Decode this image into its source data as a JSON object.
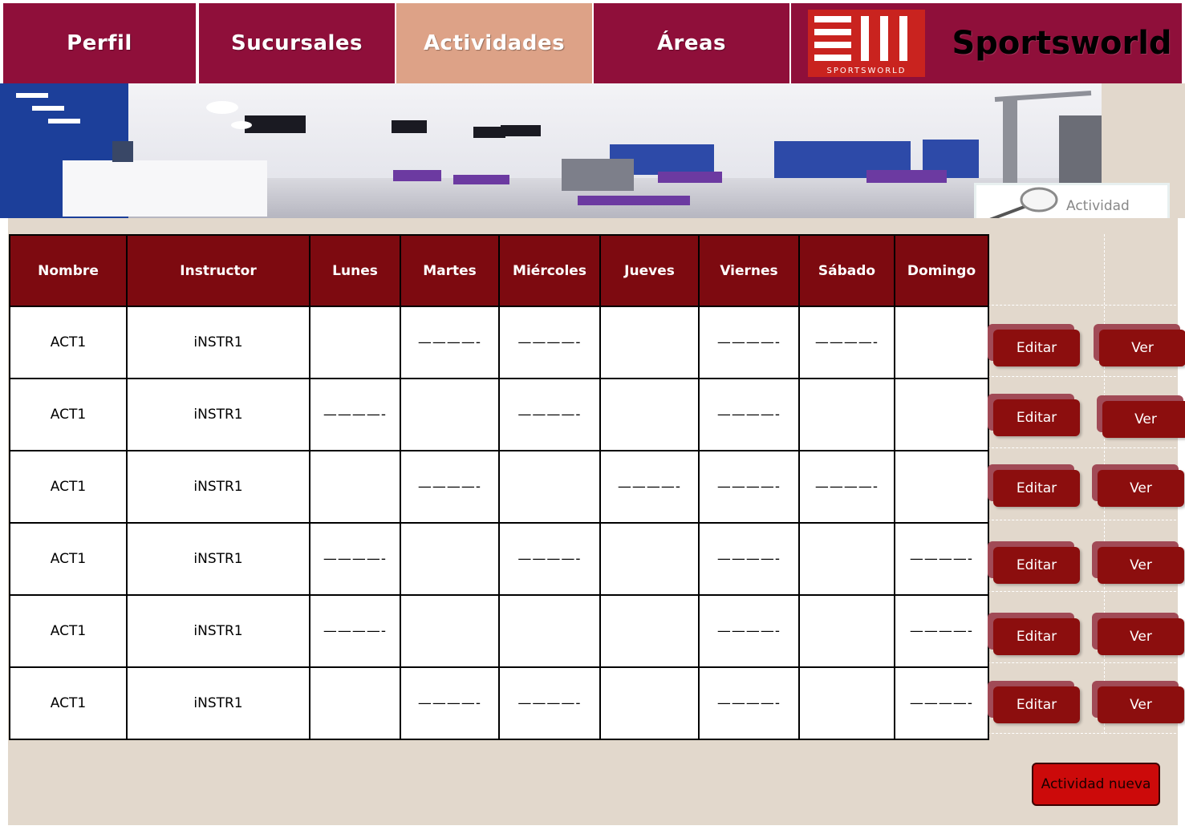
{
  "nav": {
    "tabs": [
      {
        "label": "Perfil",
        "active": false
      },
      {
        "label": "Sucursales",
        "active": false
      },
      {
        "label": "Actividades",
        "active": true
      },
      {
        "label": "Áreas",
        "active": false
      }
    ],
    "logo_caption": "SPORTSWORLD",
    "brand": "Sportsworld"
  },
  "search": {
    "placeholder": "Actividad"
  },
  "table": {
    "headers": [
      "Nombre",
      "Instructor",
      "Lunes",
      "Martes",
      "Miércoles",
      "Jueves",
      "Viernes",
      "Sábado",
      "Domingo"
    ],
    "rows": [
      [
        "ACT1",
        "iNSTR1",
        "",
        "————-",
        "————-",
        "",
        "————-",
        "————-",
        ""
      ],
      [
        "ACT1",
        "iNSTR1",
        "————-",
        "",
        "————-",
        "",
        "————-",
        "",
        ""
      ],
      [
        "ACT1",
        "iNSTR1",
        "",
        "————-",
        "",
        "————-",
        "————-",
        "————-",
        ""
      ],
      [
        "ACT1",
        "iNSTR1",
        "————-",
        "",
        "————-",
        "",
        "————-",
        "",
        "————-"
      ],
      [
        "ACT1",
        "iNSTR1",
        "————-",
        "",
        "",
        "",
        "————-",
        "",
        "————-"
      ],
      [
        "ACT1",
        "iNSTR1",
        "",
        "————-",
        "————-",
        "",
        "————-",
        "",
        "————-"
      ]
    ]
  },
  "row_actions": {
    "edit_label": "Editar",
    "view_label": "Ver"
  },
  "new_activity_label": "Actividad nueva",
  "colors": {
    "nav_bg": "#8f0f3a",
    "nav_active": "#dda287",
    "header_bg": "#7d0a10",
    "panel_bg": "#e2d8cc",
    "button_bg": "#8c0e0e",
    "new_button_bg": "#cc0a0a"
  }
}
